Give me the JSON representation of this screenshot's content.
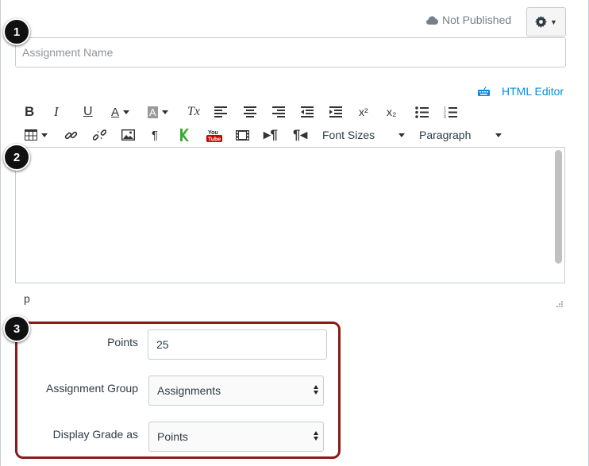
{
  "header": {
    "status_label": "Not Published",
    "status_icon": "cloud-icon",
    "settings_icon": "gear-icon"
  },
  "assignment": {
    "name_placeholder": "Assignment Name",
    "name_value": ""
  },
  "editor": {
    "html_editor_label": "HTML Editor",
    "font_sizes_label": "Font Sizes",
    "paragraph_label": "Paragraph",
    "path_label": "p",
    "toolbar_row1": [
      "B",
      "I",
      "U",
      "A",
      "A",
      "Tx",
      "align-left",
      "align-center",
      "align-right",
      "outdent",
      "indent",
      "x²",
      "x₂",
      "bullet-list",
      "number-list"
    ],
    "toolbar_row2": [
      "table",
      "link",
      "unlink",
      "image",
      "pilcrow",
      "kaltura",
      "youtube",
      "media",
      "ltr",
      "rtl"
    ]
  },
  "fields": {
    "points_label": "Points",
    "points_value": "25",
    "group_label": "Assignment Group",
    "group_value": "Assignments",
    "grade_label": "Display Grade as",
    "grade_value": "Points"
  },
  "markers": [
    "1",
    "2",
    "3"
  ],
  "colors": {
    "link": "#008ee2",
    "highlight_border": "#8b1a1a",
    "marker_bg": "#111111"
  }
}
